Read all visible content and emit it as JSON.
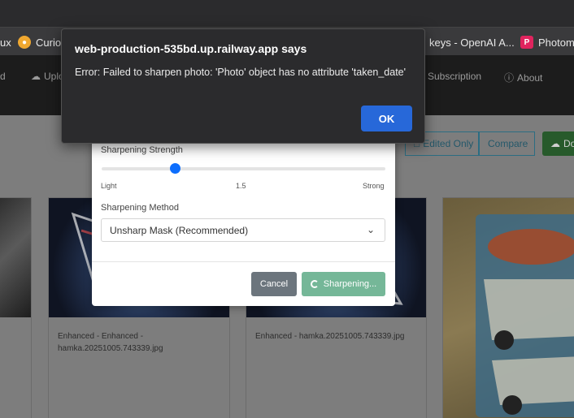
{
  "browser": {
    "bookmarks": [
      {
        "label": "ux",
        "icon": "bookmark-icon"
      },
      {
        "label": "Curio",
        "icon": "lightbulb-icon",
        "color": "#f0a830"
      },
      {
        "label": "keys - OpenAI A...",
        "icon": "bookmark-icon"
      },
      {
        "label": "Photomy",
        "icon": "photomy-icon",
        "color": "#e0245e"
      }
    ]
  },
  "app_nav": {
    "items": [
      {
        "label": "d"
      },
      {
        "label": "Uplo",
        "icon": "upload-icon"
      },
      {
        "label": "Subscription"
      },
      {
        "label": "About",
        "icon": "info-icon"
      }
    ]
  },
  "toolbar": {
    "edited_only_label": "Edited Only",
    "compare_label": "Compare",
    "download_label": "Do"
  },
  "gallery": {
    "cards": [
      {
        "caption": ""
      },
      {
        "caption": "Enhanced - Enhanced - hamka.20251005.743339.jpg"
      },
      {
        "caption": "Enhanced - hamka.20251005.743339.jpg"
      },
      {
        "caption": ""
      }
    ]
  },
  "sharpen_modal": {
    "strength_label": "Sharpening Strength",
    "strength_value": 1.5,
    "strength_fraction": 0.26,
    "tick_light": "Light",
    "tick_value": "1.5",
    "tick_strong": "Strong",
    "method_label": "Sharpening Method",
    "method_selected": "Unsharp Mask (Recommended)",
    "cancel_label": "Cancel",
    "sharpen_label": "Sharpening..."
  },
  "alert": {
    "title": "web-production-535bd.up.railway.app says",
    "message": "Error: Failed to sharpen photo: 'Photo' object has no attribute 'taken_date'",
    "ok_label": "OK"
  },
  "colors": {
    "accent": "#0d6efd",
    "ok_button": "#2768d9",
    "sharpen_button": "#75b798",
    "cancel_button": "#6c757d"
  }
}
